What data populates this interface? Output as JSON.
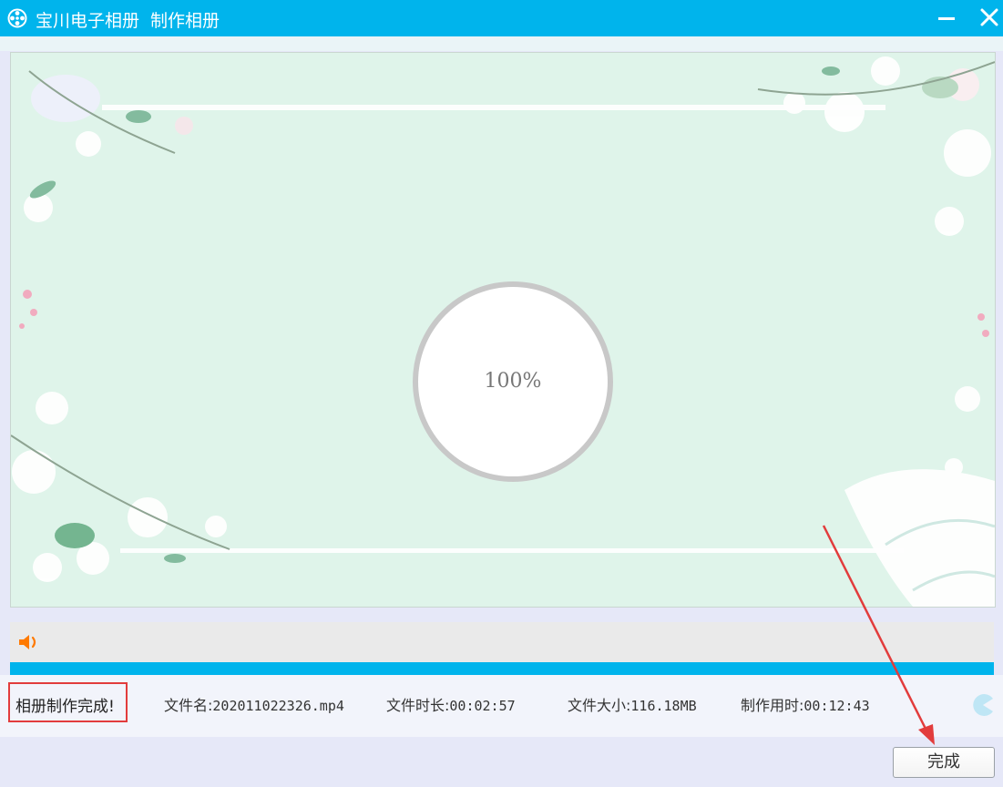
{
  "window": {
    "app_name": "宝川电子相册",
    "subtitle": "制作相册",
    "icons": {
      "app": "film-reel-icon",
      "minimize": "minimize-icon",
      "close": "close-icon"
    }
  },
  "preview": {
    "progress_label": "100%",
    "progress_value": 1.0
  },
  "player": {
    "sound_icon": "speaker-icon"
  },
  "status": {
    "message": "相册制作完成!",
    "file_name": {
      "label": "文件名:",
      "value": "202011022326.mp4"
    },
    "duration": {
      "label": "文件时长:",
      "value": "00:02:57"
    },
    "size": {
      "label": "文件大小:",
      "value": "116.18MB"
    },
    "elapsed": {
      "label": "制作用时:",
      "value": "00:12:43"
    },
    "status_icon": "pacman-icon"
  },
  "footer": {
    "finish_label": "完成"
  },
  "colors": {
    "accent": "#00b4ec",
    "highlight_box": "#e23c3c",
    "annotation_arrow": "#e23c3c"
  }
}
